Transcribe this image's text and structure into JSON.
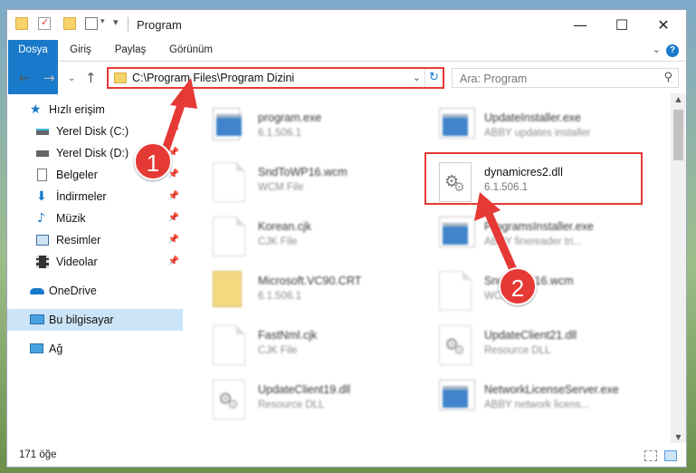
{
  "window": {
    "title": "Program",
    "controls": {
      "minimize": "—",
      "maximize": "☐",
      "close": "✕"
    }
  },
  "ribbon": {
    "tabs": [
      "Dosya",
      "Giriş",
      "Paylaş",
      "Görünüm"
    ]
  },
  "address": {
    "path": "C:\\Program Files\\Program Dizini",
    "search_placeholder": "Ara: Program"
  },
  "sidebar": {
    "items": [
      {
        "label": "Hızlı erişim",
        "icon": "star-icon"
      },
      {
        "label": "Yerel Disk (C:)",
        "icon": "drive-icon",
        "pinned": true
      },
      {
        "label": "Yerel Disk (D:)",
        "icon": "drive-icon",
        "pinned": true
      },
      {
        "label": "Belgeler",
        "icon": "documents-icon",
        "pinned": true
      },
      {
        "label": "İndirmeler",
        "icon": "download-icon",
        "pinned": true
      },
      {
        "label": "Müzik",
        "icon": "music-icon",
        "pinned": true
      },
      {
        "label": "Resimler",
        "icon": "pictures-icon",
        "pinned": true
      },
      {
        "label": "Videolar",
        "icon": "videos-icon",
        "pinned": true
      },
      {
        "label": "OneDrive",
        "icon": "cloud-icon"
      },
      {
        "label": "Bu bilgisayar",
        "icon": "computer-icon",
        "selected": true
      },
      {
        "label": "Ağ",
        "icon": "network-icon"
      }
    ]
  },
  "files": [
    {
      "name": "program.exe",
      "sub": "6.1.506.1",
      "icon": "exe-icon"
    },
    {
      "name": "UpdateInstaller.exe",
      "sub": "ABBY updates installer",
      "icon": "exe-icon"
    },
    {
      "name": "SndToWP16.wcm",
      "sub": "WCM File",
      "icon": "file-icon"
    },
    {
      "name": "dynamicres2.dll",
      "sub": "6.1.506.1",
      "icon": "dll-gear-icon"
    },
    {
      "name": "Korean.cjk",
      "sub": "CJK File",
      "icon": "file-icon"
    },
    {
      "name": "ProgramsInstaller.exe",
      "sub": "ABBY finereader tri...",
      "icon": "exe-icon"
    },
    {
      "name": "Microsoft.VC90.CRT",
      "sub": "6.1.506.1",
      "icon": "folder-icon"
    },
    {
      "name": "SndToWP16.wcm",
      "sub": "WCM File",
      "icon": "file-icon"
    },
    {
      "name": "FastNml.cjk",
      "sub": "CJK File",
      "icon": "file-icon"
    },
    {
      "name": "UpdateClient21.dll",
      "sub": "Resource DLL",
      "icon": "dll-gear-icon"
    },
    {
      "name": "UpdateClient19.dll",
      "sub": "Resource DLL",
      "icon": "dll-gear-icon"
    },
    {
      "name": "NetworkLicenseServer.exe",
      "sub": "ABBY network licens...",
      "icon": "exe-icon"
    }
  ],
  "status": {
    "count": "171 öğe"
  },
  "annotations": {
    "step1": "1",
    "step2": "2",
    "color": "#e53935"
  }
}
